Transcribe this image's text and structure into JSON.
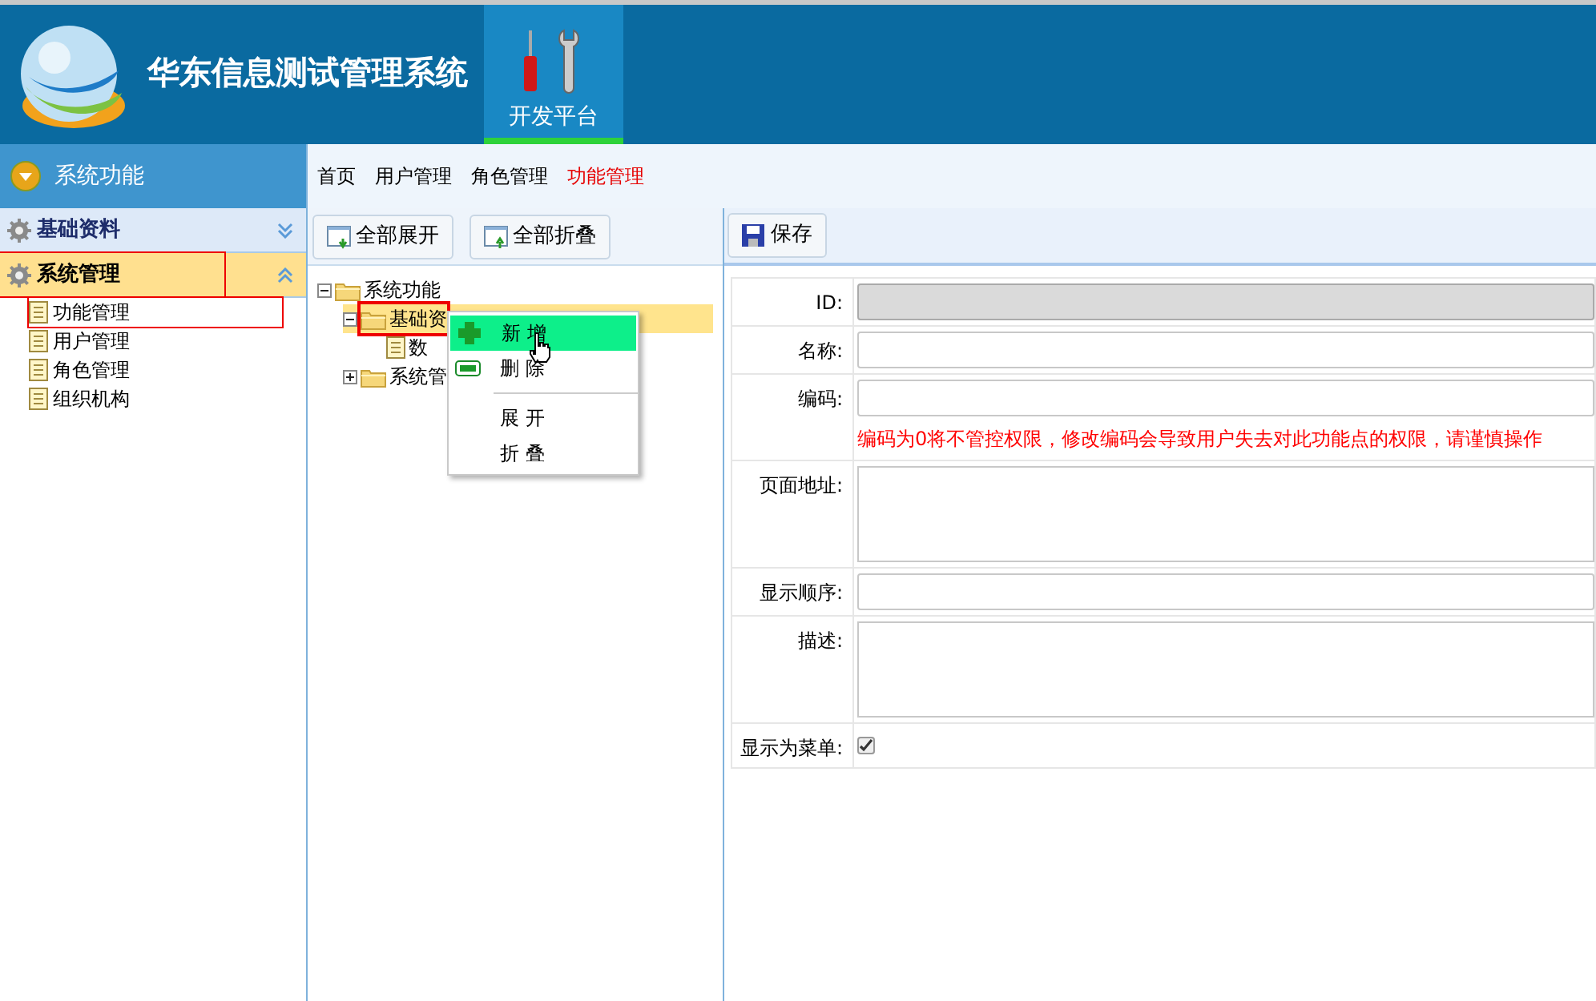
{
  "header": {
    "title": "华东信息测试管理系统",
    "nav": [
      {
        "label": "开发平台",
        "selected": true
      }
    ]
  },
  "sidebar": {
    "title": "系统功能",
    "groups": [
      {
        "label": "基础资料",
        "expanded": false,
        "outlined": false
      },
      {
        "label": "系统管理",
        "expanded": true,
        "outlined": true,
        "children": [
          {
            "label": "功能管理",
            "outlined": true
          },
          {
            "label": "用户管理",
            "outlined": false
          },
          {
            "label": "角色管理",
            "outlined": false
          },
          {
            "label": "组织机构",
            "outlined": false
          }
        ]
      }
    ]
  },
  "breadcrumb": [
    {
      "label": "首页",
      "selected": false
    },
    {
      "label": "用户管理",
      "selected": false
    },
    {
      "label": "角色管理",
      "selected": false
    },
    {
      "label": "功能管理",
      "selected": true
    }
  ],
  "tree_toolbar": [
    {
      "label": "全部展开",
      "kind": "expand"
    },
    {
      "label": "全部折叠",
      "kind": "collapse"
    }
  ],
  "tree": [
    {
      "label": "系统功能",
      "kind": "folder",
      "expanded": true,
      "selected": false,
      "outlined": false,
      "children": [
        {
          "label": "基础资",
          "kind": "folder",
          "expanded": true,
          "selected": true,
          "outlined": true,
          "children": [
            {
              "label": "数",
              "kind": "file",
              "selected": false,
              "outlined": false
            }
          ]
        },
        {
          "label": "系统管",
          "kind": "folder",
          "expanded": false,
          "selected": false,
          "outlined": false
        }
      ]
    }
  ],
  "context_menu": [
    {
      "label": "新 增",
      "kind": "add",
      "selected": true
    },
    {
      "label": "删 除",
      "kind": "remove",
      "selected": false
    },
    {
      "kind": "separator"
    },
    {
      "label": "展 开",
      "kind": "plain",
      "selected": false
    },
    {
      "label": "折 叠",
      "kind": "plain",
      "selected": false
    }
  ],
  "form_toolbar": [
    {
      "label": "保存"
    }
  ],
  "form": [
    {
      "label": "ID:",
      "kind": "text",
      "disabled": true
    },
    {
      "label": "名称:",
      "kind": "text",
      "disabled": false
    },
    {
      "label": "编码:",
      "kind": "text",
      "disabled": false,
      "hint": "编码为0将不管控权限，修改编码会导致用户失去对此功能点的权限，请谨慎操作"
    },
    {
      "label": "页面地址:",
      "kind": "textarea",
      "disabled": false
    },
    {
      "label": "显示顺序:",
      "kind": "text",
      "disabled": false
    },
    {
      "label": "描述:",
      "kind": "textarea",
      "disabled": false
    },
    {
      "label": "显示为菜单:",
      "kind": "checkbox",
      "checked": true
    }
  ]
}
